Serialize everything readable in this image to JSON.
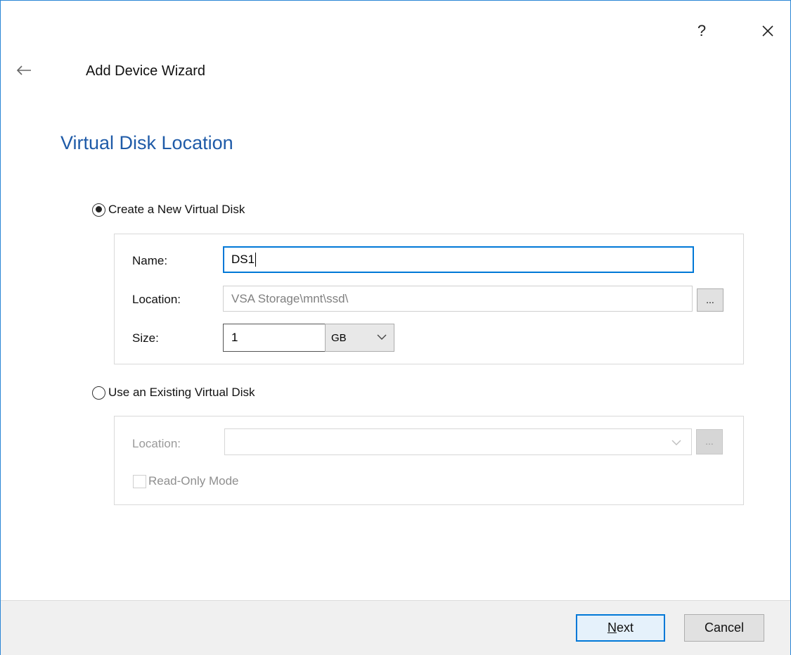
{
  "window": {
    "help_label": "?",
    "wizard_title": "Add Device Wizard"
  },
  "page": {
    "heading": "Virtual Disk Location"
  },
  "create_new": {
    "label": "Create a New Virtual Disk",
    "selected": true,
    "name_label": "Name:",
    "name_value": "DS1",
    "location_label": "Location:",
    "location_value": "VSA Storage\\mnt\\ssd\\",
    "browse_label": "...",
    "size_label": "Size:",
    "size_value": "1",
    "size_unit": "GB"
  },
  "use_existing": {
    "label": "Use an Existing Virtual Disk",
    "selected": false,
    "location_label": "Location:",
    "location_value": "",
    "browse_label": "...",
    "readonly_label": "Read-Only Mode",
    "readonly_checked": false
  },
  "footer": {
    "next_mnemonic": "N",
    "next_rest": "ext",
    "cancel_label": "Cancel"
  },
  "colors": {
    "accent": "#0078d7",
    "heading": "#1f5ba8",
    "footer_bg": "#f0f0f0"
  }
}
